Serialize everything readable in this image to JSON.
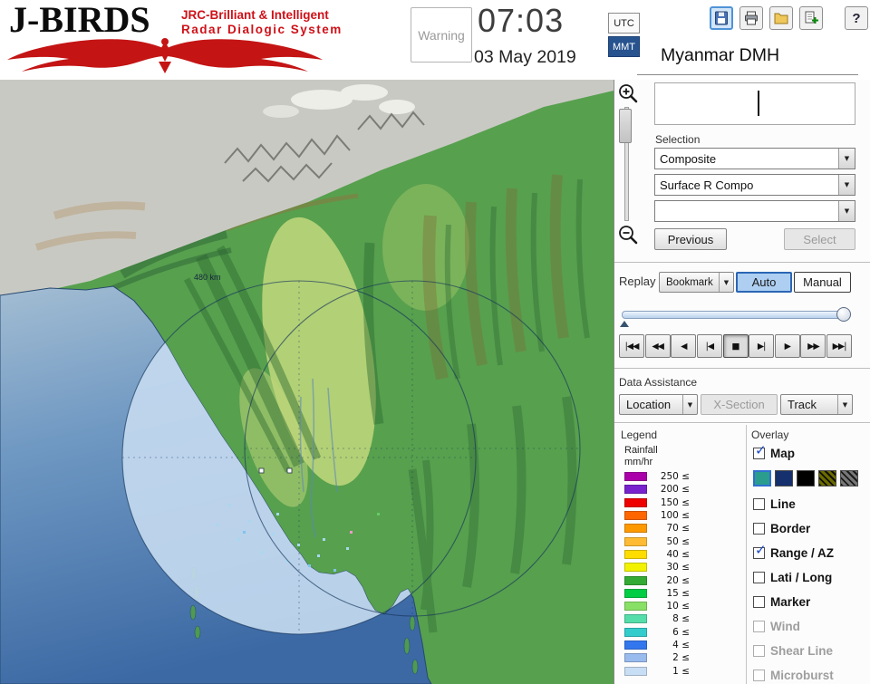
{
  "header": {
    "logo": {
      "title": "J-BIRDS",
      "subtitle1": "JRC-Brilliant & Intelligent",
      "subtitle2": "Radar  Dialogic  System"
    },
    "warning": "Warning",
    "time": "07:03",
    "date": "03 May 2019",
    "tz_utc": "UTC",
    "tz_mmt": "MMT",
    "help": "?",
    "org": "Myanmar DMH"
  },
  "map": {
    "range_label": "480 km"
  },
  "panel": {
    "selection_label": "Selection",
    "combo_composite": "Composite",
    "combo_surface": "Surface R Compo",
    "combo_blank": "",
    "previous": "Previous",
    "select": "Select",
    "replay_label": "Replay",
    "bookmark": "Bookmark",
    "auto": "Auto",
    "manual": "Manual",
    "playback": [
      {
        "name": "jump-first",
        "glyph": "|◀◀"
      },
      {
        "name": "rewind",
        "glyph": "◀◀"
      },
      {
        "name": "play-backward",
        "glyph": "◀"
      },
      {
        "name": "step-backward",
        "glyph": "|◀"
      },
      {
        "name": "stop",
        "glyph": "■"
      },
      {
        "name": "step-forward",
        "glyph": "▶|"
      },
      {
        "name": "play-forward",
        "glyph": "▶"
      },
      {
        "name": "fast-forward",
        "glyph": "▶▶"
      },
      {
        "name": "jump-last",
        "glyph": "▶▶|"
      }
    ],
    "data_assistance_label": "Data Assistance",
    "location": "Location",
    "xsection": "X-Section",
    "track": "Track"
  },
  "legend": {
    "label": "Legend",
    "unit1": "Rainfall",
    "unit2": "mm/hr",
    "scale": [
      {
        "value": "250 ≤",
        "color": "#aa00aa"
      },
      {
        "value": "200 ≤",
        "color": "#7722cc"
      },
      {
        "value": "150 ≤",
        "color": "#ee0000"
      },
      {
        "value": "100 ≤",
        "color": "#ff6600"
      },
      {
        "value": "70 ≤",
        "color": "#ff9900"
      },
      {
        "value": "50 ≤",
        "color": "#ffbb33"
      },
      {
        "value": "40 ≤",
        "color": "#ffdd00"
      },
      {
        "value": "30 ≤",
        "color": "#f2f200"
      },
      {
        "value": "20 ≤",
        "color": "#33aa33"
      },
      {
        "value": "15 ≤",
        "color": "#00cc44"
      },
      {
        "value": "10 ≤",
        "color": "#88e066"
      },
      {
        "value": "8 ≤",
        "color": "#55ddaa"
      },
      {
        "value": "6 ≤",
        "color": "#33cccc"
      },
      {
        "value": "4 ≤",
        "color": "#3377ee"
      },
      {
        "value": "2 ≤",
        "color": "#99bbee"
      },
      {
        "value": "1 ≤",
        "color": "#c8def5"
      }
    ]
  },
  "overlay": {
    "label": "Overlay",
    "items": [
      {
        "label": "Map",
        "checked": true,
        "enabled": true
      },
      {
        "label": "Line",
        "checked": false,
        "enabled": true
      },
      {
        "label": "Border",
        "checked": false,
        "enabled": true
      },
      {
        "label": "Range / AZ",
        "checked": true,
        "enabled": true
      },
      {
        "label": "Lati / Long",
        "checked": false,
        "enabled": true
      },
      {
        "label": "Marker",
        "checked": false,
        "enabled": true
      },
      {
        "label": "Wind",
        "checked": false,
        "enabled": false
      },
      {
        "label": "Shear Line",
        "checked": false,
        "enabled": false
      },
      {
        "label": "Microburst",
        "checked": false,
        "enabled": false
      }
    ],
    "swatch_colors": [
      "#2a9d8f",
      "#16306e",
      "#000000",
      "#6b6b00",
      "#777777"
    ]
  }
}
